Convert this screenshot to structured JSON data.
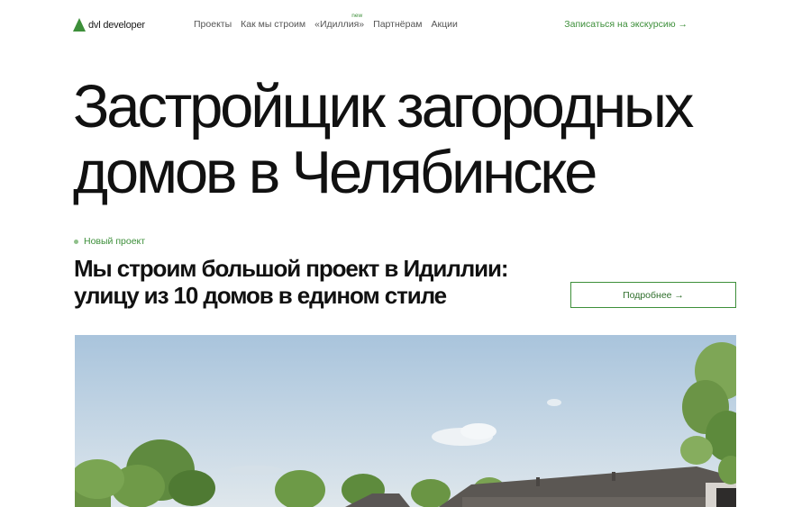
{
  "header": {
    "logo_text": "dvl developer",
    "nav": [
      {
        "label": "Проекты"
      },
      {
        "label": "Как мы строим"
      },
      {
        "label": "«Идиллия»",
        "badge": "new"
      },
      {
        "label": "Партнёрам"
      },
      {
        "label": "Акции"
      }
    ],
    "cta": "Записаться на экскурсию →"
  },
  "hero": {
    "title_line1": "Застройщик загородных",
    "title_line2": "домов в Челябинске"
  },
  "project": {
    "tag": "Новый проект",
    "subtitle_line1": "Мы строим большой проект в Идиллии:",
    "subtitle_line2": "улицу из 10 домов в едином стиле",
    "button": "Подробнее →"
  },
  "colors": {
    "accent": "#3d8f3a",
    "tag_dot": "#8fc08a",
    "text": "#111111",
    "nav_text": "#555555"
  },
  "icons": {
    "logo": "triangle-logo-icon",
    "tag": "dot-icon"
  }
}
